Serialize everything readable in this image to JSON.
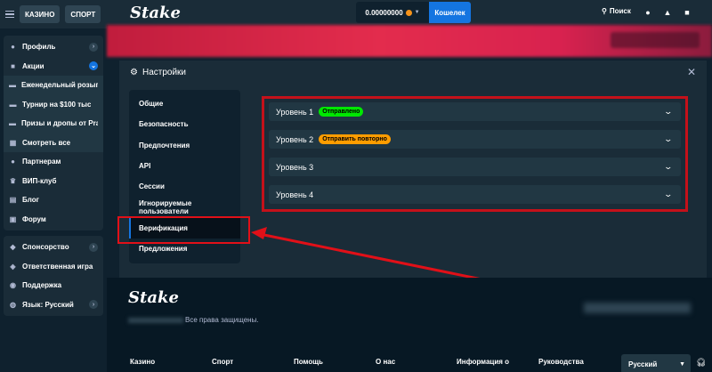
{
  "topbar": {
    "logo": "Stake",
    "balance": "0.00000000",
    "wallet_label": "Кошелек",
    "search_label": "Поиск"
  },
  "sidebar": {
    "tabs": [
      "КАЗИНО",
      "СПОРТ"
    ],
    "groups": [
      {
        "items": [
          {
            "label": "Профиль",
            "icon": "user-icon"
          },
          {
            "label": "Акции",
            "icon": "gift-icon"
          }
        ]
      },
      {
        "items": [
          {
            "label": "Еженедельный розыгрыш",
            "icon": "ticket-icon"
          },
          {
            "label": "Турнир на $100 тыс",
            "icon": "trophy-icon"
          },
          {
            "label": "Призы и дропы от Pragmatic",
            "icon": "gift-icon"
          },
          {
            "label": "Смотреть все",
            "icon": "grid-icon"
          }
        ]
      },
      {
        "items": [
          {
            "label": "Партнерам",
            "icon": "people-icon"
          },
          {
            "label": "ВИП-клуб",
            "icon": "crown-icon"
          },
          {
            "label": "Блог",
            "icon": "blog-icon"
          },
          {
            "label": "Форум",
            "icon": "forum-icon"
          }
        ]
      },
      {
        "items": [
          {
            "label": "Спонсорство",
            "icon": "sponsor-icon"
          },
          {
            "label": "Ответственная игра",
            "icon": "shield-icon"
          },
          {
            "label": "Поддержка",
            "icon": "support-icon"
          },
          {
            "label": "Язык: Русский",
            "icon": "globe-icon"
          }
        ]
      }
    ]
  },
  "modal": {
    "title": "Настройки",
    "menu": [
      "Общие",
      "Безопасность",
      "Предпочтения",
      "API",
      "Сессии",
      "Игнорируемые пользователи",
      "Верификация",
      "Предложения"
    ],
    "active_menu_item": "Верификация",
    "levels": [
      {
        "label": "Уровень 1",
        "badge": "Отправлено",
        "badge_color": "#00e701"
      },
      {
        "label": "Уровень 2",
        "badge": "Отправить повторно",
        "badge_color": "#ff9d00"
      },
      {
        "label": "Уровень 3",
        "badge": ""
      },
      {
        "label": "Уровень 4",
        "badge": ""
      }
    ]
  },
  "footer": {
    "logo": "Stake",
    "rights": "Все права защищены.",
    "columns": [
      "Казино",
      "Спорт",
      "Помощь",
      "О нас",
      "Информация о",
      "Руководства"
    ],
    "language": "Русский"
  },
  "colors": {
    "accent": "#1475e1",
    "background": "#0f212e",
    "panel": "#1a2c38",
    "highlight_border": "#e11018"
  }
}
